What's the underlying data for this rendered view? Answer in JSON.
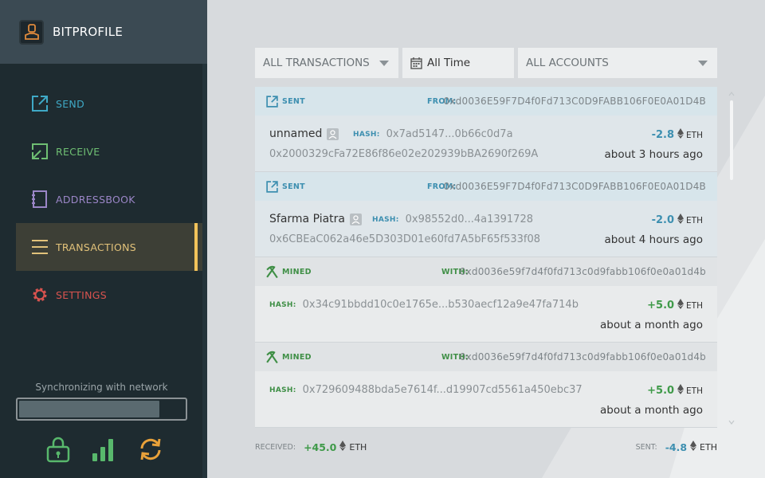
{
  "app": {
    "name": "BITPROFILE"
  },
  "sidebar": {
    "items": [
      {
        "label": "SEND",
        "icon": "send-icon"
      },
      {
        "label": "RECEIVE",
        "icon": "receive-icon"
      },
      {
        "label": "ADDRESSBOOK",
        "icon": "addressbook-icon"
      },
      {
        "label": "TRANSACTIONS",
        "icon": "transactions-icon",
        "active": true
      },
      {
        "label": "SETTINGS",
        "icon": "settings-icon"
      }
    ],
    "sync_text": "Synchronizing with network",
    "sync_progress": 0.85,
    "status_icons": [
      "lock-icon",
      "signal-icon",
      "refresh-icon"
    ]
  },
  "filters": {
    "type": "ALL TRANSACTIONS",
    "time": "All Time",
    "accounts": "ALL ACCOUNTS"
  },
  "transactions": [
    {
      "kind": "SENT",
      "from_label": "FROM:",
      "from": "0xd0036E59F7D4f0Fd713C0D9FABB106F0E0A01D4B",
      "name": "unnamed",
      "hash_label": "HASH:",
      "hash": "0x7ad5147...0b66c0d7a",
      "to": "0x2000329cFa72E86f86e02e202939bBA2690f269A",
      "amount": "-2.8",
      "unit": "ETH",
      "time": "about 3 hours ago"
    },
    {
      "kind": "SENT",
      "from_label": "FROM:",
      "from": "0xd0036E59F7D4f0Fd713C0D9FABB106F0E0A01D4B",
      "name": "Sfarma Piatra",
      "hash_label": "HASH:",
      "hash": "0x98552d0...4a1391728",
      "to": "0x6CBEaC062a46e5D303D01e60fd7A5bF65f533f08",
      "amount": "-2.0",
      "unit": "ETH",
      "time": "about 4 hours ago"
    },
    {
      "kind": "MINED",
      "from_label": "WITH:",
      "from": "0xd0036e59f7d4f0fd713c0d9fabb106f0e0a01d4b",
      "hash_label": "HASH:",
      "hash": "0x34c91bbdd10c0e1765e...b530aecf12a9e47fa714b",
      "amount": "+5.0",
      "unit": "ETH",
      "time": "about a month ago"
    },
    {
      "kind": "MINED",
      "from_label": "WITH:",
      "from": "0xd0036e59f7d4f0fd713c0d9fabb106f0e0a01d4b",
      "hash_label": "HASH:",
      "hash": "0x729609488bda5e7614f...d19907cd5561a450ebc37",
      "amount": "+5.0",
      "unit": "ETH",
      "time": "about a month ago"
    }
  ],
  "footer": {
    "received_label": "RECEIVED:",
    "received_value": "+45.0",
    "sent_label": "SENT:",
    "sent_value": "-4.8",
    "unit": "ETH"
  },
  "colors": {
    "sidebar_bg": "#1e2b30",
    "send": "#3fa9c6",
    "receive": "#6fbf73",
    "addressbook": "#9b86c7",
    "transactions": "#e2c27a",
    "settings": "#d9534f",
    "mined_green": "#3f9a49",
    "sent_blue": "#3d8fb0"
  }
}
